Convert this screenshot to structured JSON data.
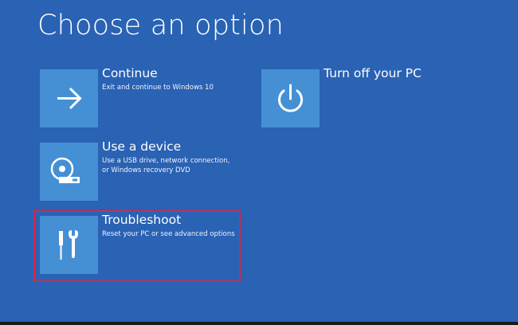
{
  "page": {
    "title": "Choose an option"
  },
  "options": {
    "continue": {
      "title": "Continue",
      "desc_lines": [
        "Exit and continue to Windows 10"
      ],
      "icon": "arrow-right-icon"
    },
    "device": {
      "title": "Use a device",
      "desc_lines": [
        "Use a USB drive, network connection,",
        "or Windows recovery DVD"
      ],
      "icon": "disc-drive-icon"
    },
    "troubleshoot": {
      "title": "Troubleshoot",
      "desc_lines": [
        "Reset your PC or see advanced options"
      ],
      "icon": "tools-icon"
    },
    "turn_off": {
      "title": "Turn off your PC",
      "desc_lines": [],
      "icon": "power-icon"
    }
  },
  "colors": {
    "background": "#2a62b4",
    "tile": "#4590d4",
    "highlight": "#d8264a"
  }
}
